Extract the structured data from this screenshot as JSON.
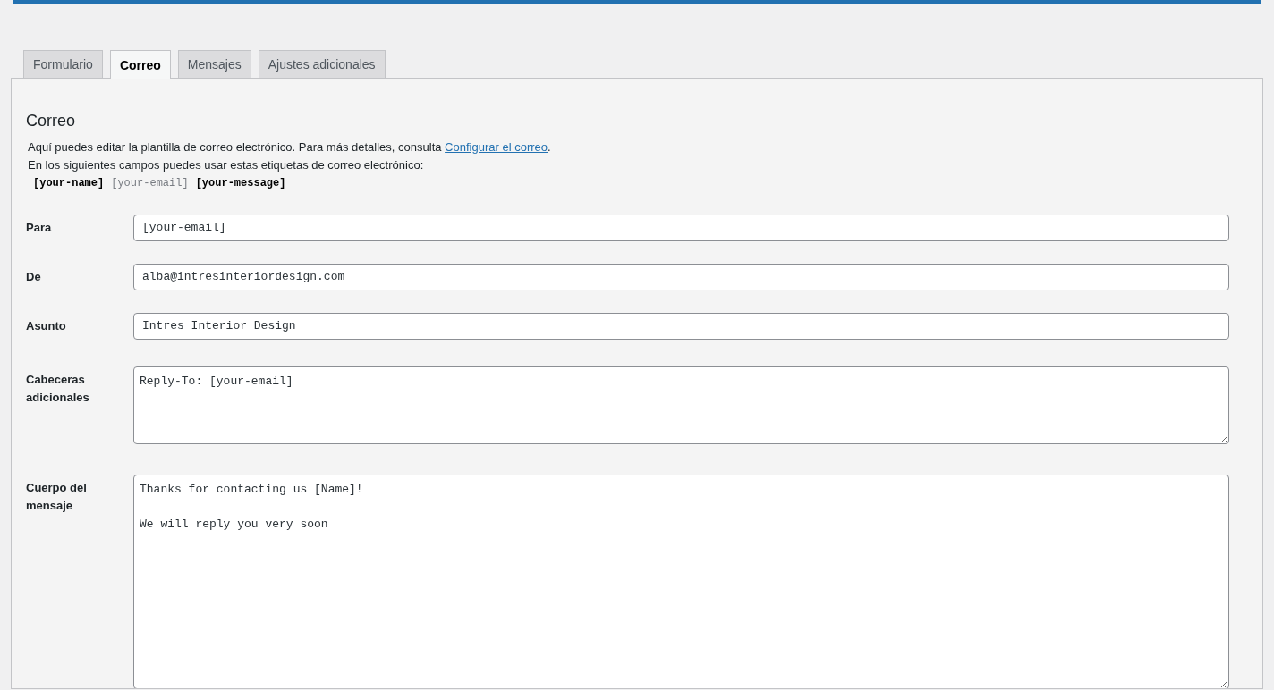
{
  "tabs": [
    {
      "label": "Formulario",
      "selected": false
    },
    {
      "label": "Correo",
      "selected": true
    },
    {
      "label": "Mensajes",
      "selected": false
    },
    {
      "label": "Ajustes adicionales",
      "selected": false
    }
  ],
  "panel": {
    "heading": "Correo",
    "intro": {
      "text": "Aquí puedes editar la plantilla de correo electrónico. Para más detalles, consulta ",
      "link": "Configurar el correo",
      "after": "."
    },
    "tags_note": "En los siguientes campos puedes usar estas etiquetas de correo electrónico:",
    "mail_tags": [
      {
        "tag": "[your-name]",
        "used": false
      },
      {
        "tag": "[your-email]",
        "used": true
      },
      {
        "tag": "[your-message]",
        "used": false
      }
    ],
    "fields": [
      {
        "label": "Para",
        "kind": "input",
        "value": "[your-email]"
      },
      {
        "label": "De",
        "kind": "input",
        "value": "alba@intresinteriordesign.com"
      },
      {
        "label": "Asunto",
        "kind": "input",
        "value": "Intres Interior Design"
      },
      {
        "label": "Cabeceras adicionales",
        "kind": "textarea",
        "value": "Reply-To: [your-email]"
      },
      {
        "label": "Cuerpo del mensaje",
        "kind": "bodyarea",
        "value": "Thanks for contacting us [Name]!\n\nWe will reply you very soon"
      }
    ]
  }
}
